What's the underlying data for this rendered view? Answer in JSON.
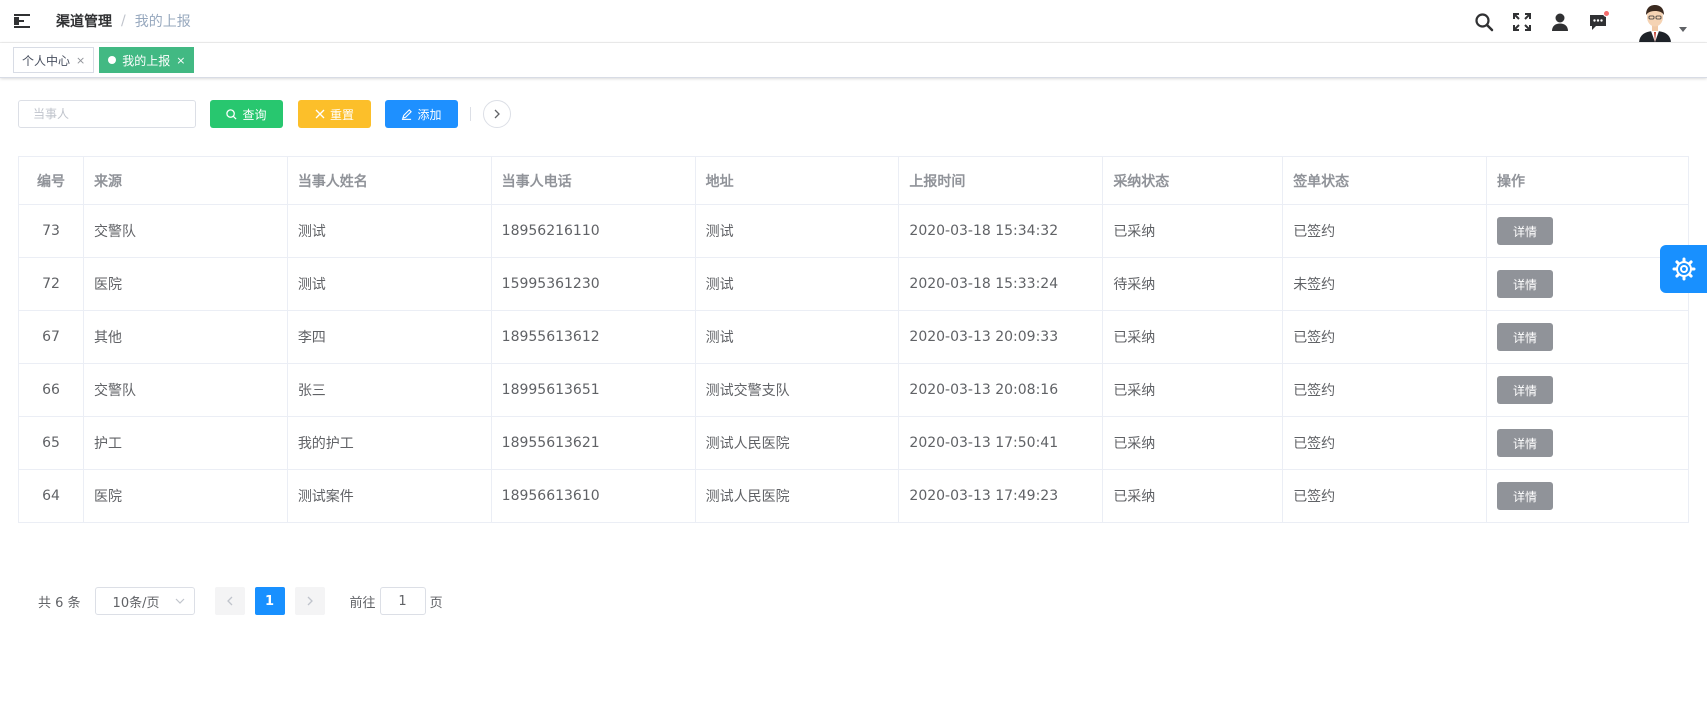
{
  "header": {
    "breadcrumb": [
      "渠道管理",
      "我的上报"
    ],
    "separator": "/"
  },
  "tags": [
    {
      "label": "个人中心",
      "active": false
    },
    {
      "label": "我的上报",
      "active": true
    }
  ],
  "tag_close": "×",
  "toolbar": {
    "search_placeholder": "当事人",
    "query_label": "查询",
    "reset_label": "重置",
    "add_label": "添加"
  },
  "table": {
    "columns": [
      "编号",
      "来源",
      "当事人姓名",
      "当事人电话",
      "地址",
      "上报时间",
      "采纳状态",
      "签单状态",
      "操作"
    ],
    "rows": [
      {
        "id": "73",
        "source": "交警队",
        "name": "测试",
        "phone": "18956216110",
        "address": "测试",
        "time": "2020-03-18 15:34:32",
        "adopt": "已采纳",
        "sign": "已签约",
        "action": "详情"
      },
      {
        "id": "72",
        "source": "医院",
        "name": "测试",
        "phone": "15995361230",
        "address": "测试",
        "time": "2020-03-18 15:33:24",
        "adopt": "待采纳",
        "sign": "未签约",
        "action": "详情"
      },
      {
        "id": "67",
        "source": "其他",
        "name": "李四",
        "phone": "18955613612",
        "address": "测试",
        "time": "2020-03-13 20:09:33",
        "adopt": "已采纳",
        "sign": "已签约",
        "action": "详情"
      },
      {
        "id": "66",
        "source": "交警队",
        "name": "张三",
        "phone": "18995613651",
        "address": "测试交警支队",
        "time": "2020-03-13 20:08:16",
        "adopt": "已采纳",
        "sign": "已签约",
        "action": "详情"
      },
      {
        "id": "65",
        "source": "护工",
        "name": "我的护工",
        "phone": "18955613621",
        "address": "测试人民医院",
        "time": "2020-03-13 17:50:41",
        "adopt": "已采纳",
        "sign": "已签约",
        "action": "详情"
      },
      {
        "id": "64",
        "source": "医院",
        "name": "测试案件",
        "phone": "18956613610",
        "address": "测试人民医院",
        "time": "2020-03-13 17:49:23",
        "adopt": "已采纳",
        "sign": "已签约",
        "action": "详情"
      }
    ]
  },
  "pagination": {
    "total": "共 6 条",
    "page_size": "10条/页",
    "current_page": "1",
    "jump_prefix": "前往",
    "jump_value": "1",
    "jump_suffix": "页"
  },
  "colors": {
    "query": "#28c76f",
    "reset": "#fcbf2a",
    "add": "#1e90ff",
    "active_tag": "#42b983",
    "settings": "#1890ff",
    "detail": "#909399"
  },
  "icons": [
    "hamburger-icon",
    "search-icon",
    "fullscreen-icon",
    "user-icon",
    "message-icon",
    "settings-gear-icon"
  ]
}
